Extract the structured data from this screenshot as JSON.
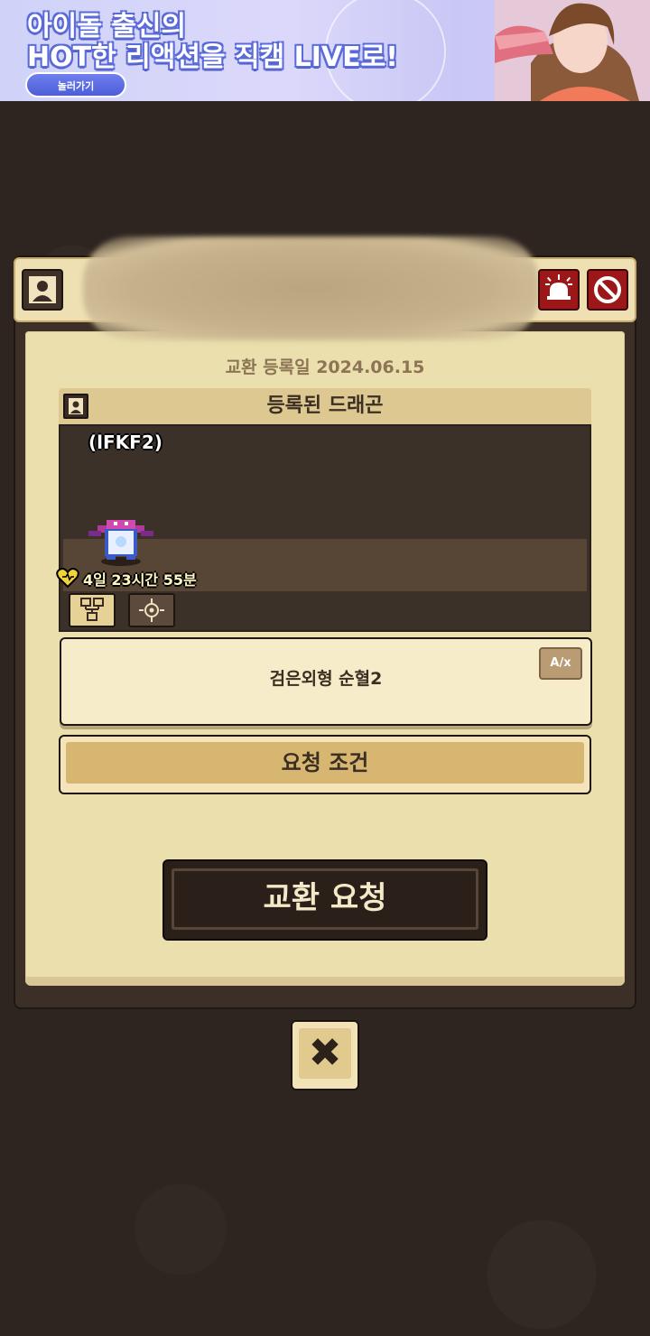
{
  "banner": {
    "line1": "아이돌 출신의",
    "line2": "HOT한 리액션을 직캠 LIVE로!",
    "button_label": "놀러가기"
  },
  "panel": {
    "reg_date": "교환 등록일 2024.06.15",
    "section_title": "등록된 드래곤",
    "dragon_name": "(lFKF2)",
    "timer": "4일 23시간 55분",
    "description": "검은외형 순혈2",
    "translate_label": "A/x",
    "conditions_label": "요청 조건",
    "trade_request_label": "교환 요청"
  },
  "colors": {
    "background": "#2e2520",
    "paper": "#ebdfae",
    "alert_red": "#9c1818",
    "button_dark": "#2a1f19",
    "text_dark": "#3b2e22"
  },
  "icons": {
    "profile": "profile-icon",
    "alarm": "siren-icon",
    "block": "block-icon",
    "tree": "tree-icon",
    "target": "target-icon",
    "heart_timer": "heart-icon",
    "close": "close-icon"
  }
}
